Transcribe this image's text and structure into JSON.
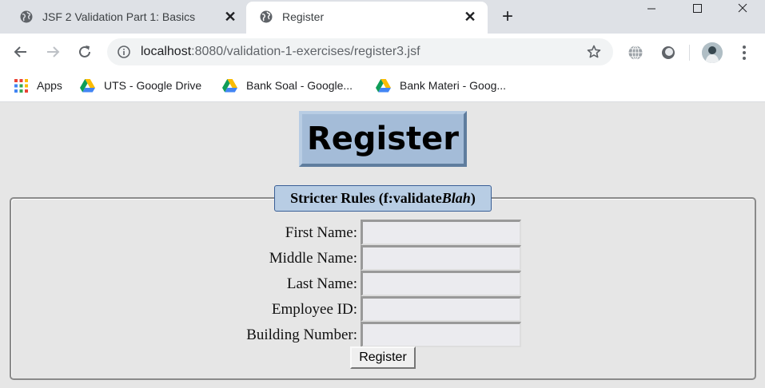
{
  "browser": {
    "tabs": [
      {
        "title": "JSF 2 Validation Part 1: Basics",
        "active": false,
        "favicon": "globe-icon"
      },
      {
        "title": "Register",
        "active": true,
        "favicon": "globe-icon"
      }
    ],
    "new_tab_glyph": "+",
    "close_glyph": "✕",
    "address": {
      "host": "localhost",
      "rest": ":8080/validation-1-exercises/register3.jsf"
    },
    "bookmarks": [
      {
        "label": "Apps",
        "icon": "apps-grid-icon"
      },
      {
        "label": "UTS - Google Drive",
        "icon": "google-drive-icon"
      },
      {
        "label": "Bank Soal - Google...",
        "icon": "google-drive-icon"
      },
      {
        "label": "Bank Materi - Goog...",
        "icon": "google-drive-icon"
      }
    ]
  },
  "page": {
    "title": "Register",
    "fieldset_legend_prefix": "Stricter Rules (f:validate",
    "fieldset_legend_italic": "Blah",
    "fieldset_legend_suffix": ")",
    "fields": [
      {
        "label": "First Name:",
        "value": ""
      },
      {
        "label": "Middle Name:",
        "value": ""
      },
      {
        "label": "Last Name:",
        "value": ""
      },
      {
        "label": "Employee ID:",
        "value": ""
      },
      {
        "label": "Building Number:",
        "value": ""
      }
    ],
    "submit_label": "Register"
  },
  "colors": {
    "title_bg": "#a4bcd8",
    "legend_bg": "#b8cde4",
    "page_bg": "#e6e6e6",
    "tabstrip_bg": "#dee1e6"
  }
}
